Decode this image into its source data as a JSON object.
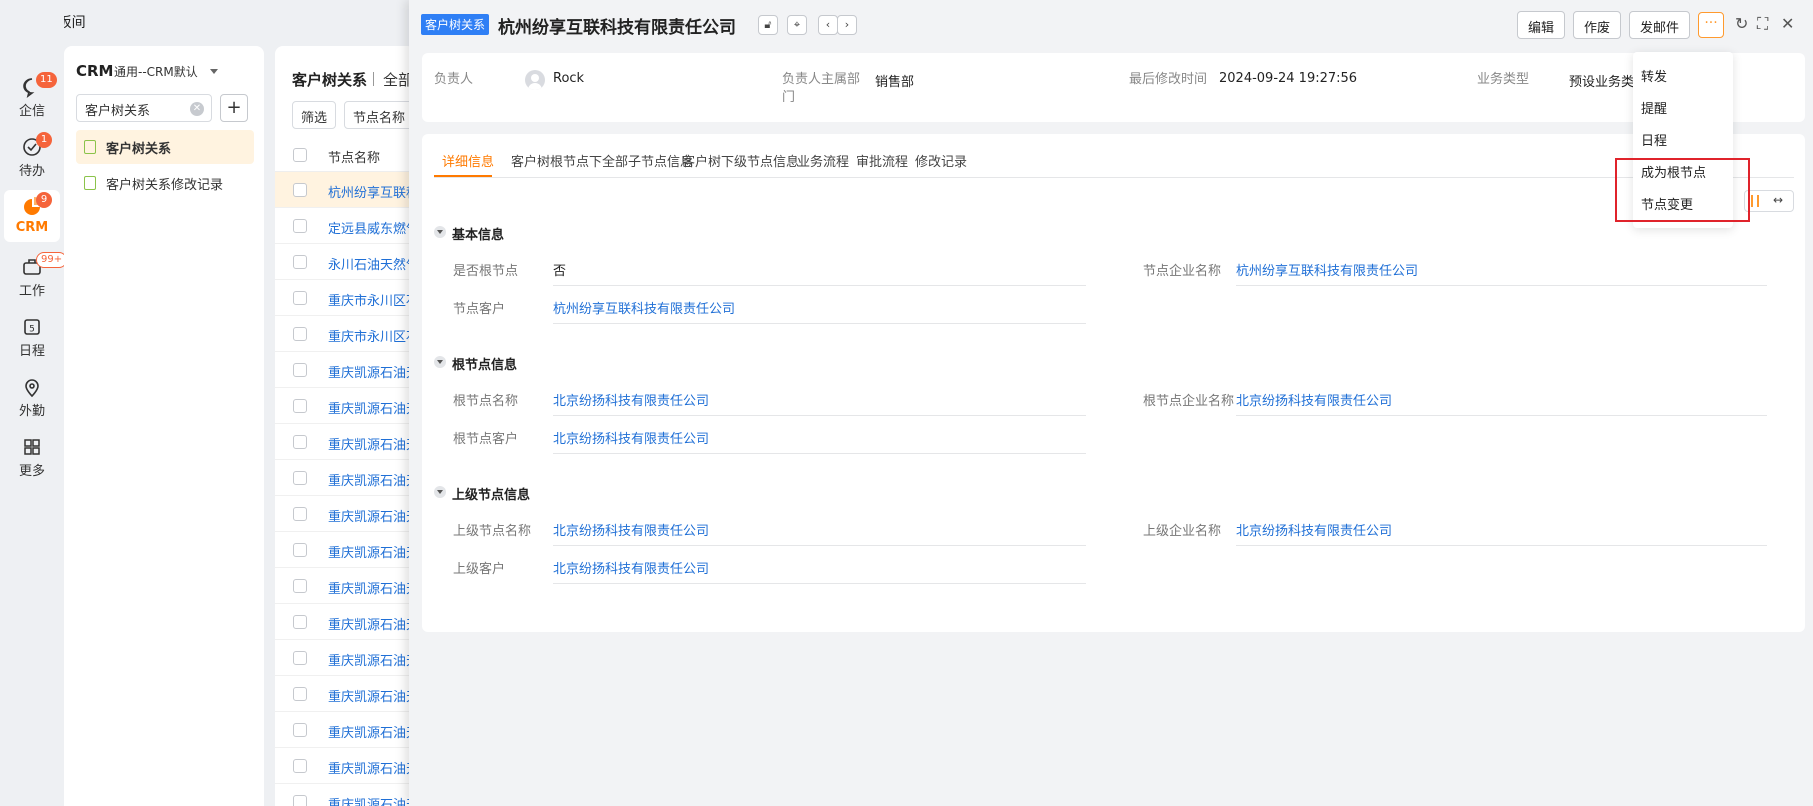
{
  "app": {
    "title": "MCR样板间"
  },
  "rail": [
    {
      "key": "qixin",
      "label": "企信",
      "badge": "11",
      "icon": "chat-bubble-icon"
    },
    {
      "key": "daiban",
      "label": "待办",
      "badge": "1",
      "icon": "check-circle-icon"
    },
    {
      "key": "crm",
      "label": "CRM",
      "badge": "9",
      "icon": "crm-icon",
      "active": true
    },
    {
      "key": "gongzuo",
      "label": "工作",
      "badge": "99+",
      "icon": "briefcase-icon"
    },
    {
      "key": "richeng",
      "label": "日程",
      "badge": "",
      "icon": "calendar-icon",
      "day": "5"
    },
    {
      "key": "waiqin",
      "label": "外勤",
      "badge": "",
      "icon": "location-pin-icon"
    },
    {
      "key": "gengduo",
      "label": "更多",
      "badge": "",
      "icon": "grid-icon"
    }
  ],
  "crm_panel": {
    "title": "CRM",
    "subtitle": "通用--CRM默认",
    "search_value": "客户树关系",
    "items": [
      {
        "label": "客户树关系",
        "active": true
      },
      {
        "label": "客户树关系修改记录"
      }
    ]
  },
  "list": {
    "title": "客户树关系",
    "scope": "全部",
    "filter_label": "筛选",
    "field_button": "节点名称",
    "column_header": "节点名称",
    "rows": [
      "杭州纷享互联科技有限责任公司",
      "定远县威东燃气有限公司",
      "永川石油天然气有限公司",
      "重庆市永川区石油有限公司",
      "重庆市永川区石油有限公司",
      "重庆凯源石油天然气有限公司",
      "重庆凯源石油天然气有限公司",
      "重庆凯源石油天然气有限公司",
      "重庆凯源石油天然气有限公司",
      "重庆凯源石油天然气有限公司",
      "重庆凯源石油天然气有限公司",
      "重庆凯源石油天然气有限公司",
      "重庆凯源石油天然气有限公司",
      "重庆凯源石油天然气有限公司",
      "重庆凯源石油天然气有限公司",
      "重庆凯源石油天然气有限公司",
      "重庆凯源石油天然气有限公司",
      "重庆凯源石油天然气有限公司"
    ]
  },
  "detail": {
    "tag": "客户树关系",
    "title": "杭州纷享互联科技有限责任公司",
    "actions": {
      "edit": "编辑",
      "void": "作废",
      "email": "发邮件",
      "more": "···"
    },
    "summary": {
      "owner_label": "负责人",
      "owner_value": "Rock",
      "dept_label_1": "负责人主属部",
      "dept_label_2": "门",
      "dept_value": "销售部",
      "modified_label": "最后修改时间",
      "modified_value": "2024-09-24 19:27:56",
      "biztype_label": "业务类型",
      "biztype_value": "预设业务类型"
    },
    "tabs": [
      "详细信息",
      "客户树根节点下全部子节点信息",
      "客户树下级节点信息",
      "业务流程",
      "审批流程",
      "修改记录"
    ],
    "sections": {
      "basic": {
        "title": "基本信息",
        "is_root_label": "是否根节点",
        "is_root_value": "否",
        "node_company_label": "节点企业名称",
        "node_company_value": "杭州纷享互联科技有限责任公司",
        "node_customer_label": "节点客户",
        "node_customer_value": "杭州纷享互联科技有限责任公司"
      },
      "root": {
        "title": "根节点信息",
        "root_name_label": "根节点名称",
        "root_name_value": "北京纷扬科技有限责任公司",
        "root_company_label": "根节点企业名称",
        "root_company_value": "北京纷扬科技有限责任公司",
        "root_customer_label": "根节点客户",
        "root_customer_value": "北京纷扬科技有限责任公司"
      },
      "parent": {
        "title": "上级节点信息",
        "parent_name_label": "上级节点名称",
        "parent_name_value": "北京纷扬科技有限责任公司",
        "parent_company_label": "上级企业名称",
        "parent_company_value": "北京纷扬科技有限责任公司",
        "parent_customer_label": "上级客户",
        "parent_customer_value": "北京纷扬科技有限责任公司"
      }
    }
  },
  "more_menu": {
    "items": [
      "转发",
      "提醒",
      "日程",
      "成为根节点",
      "节点变更"
    ]
  },
  "colors": {
    "accent": "#ff7a00",
    "link": "#1f6fd6",
    "tag": "#2f7ff5",
    "badge": "#f5643b",
    "highlight": "#e0232b"
  }
}
